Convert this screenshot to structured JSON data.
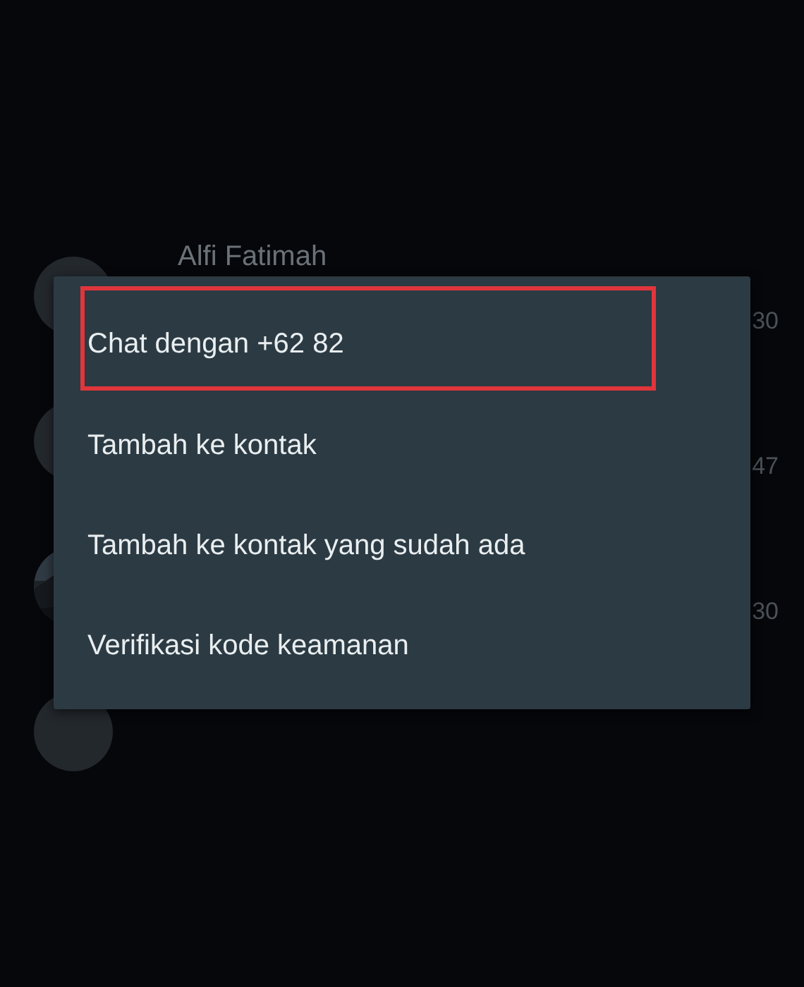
{
  "chats": [
    {
      "name": "Alfi Fatimah",
      "time": "30",
      "kind": "plain"
    },
    {
      "time": "47",
      "kind": "plain"
    },
    {
      "time": "30",
      "kind": "picture"
    },
    {
      "kind": "plain"
    }
  ],
  "menu": {
    "items": [
      {
        "label": "Chat dengan +62 82",
        "highlighted": true
      },
      {
        "label": "Tambah ke kontak",
        "highlighted": false
      },
      {
        "label": "Tambah ke kontak yang sudah ada",
        "highlighted": false
      },
      {
        "label": "Verifikasi kode keamanan",
        "highlighted": false
      }
    ]
  }
}
